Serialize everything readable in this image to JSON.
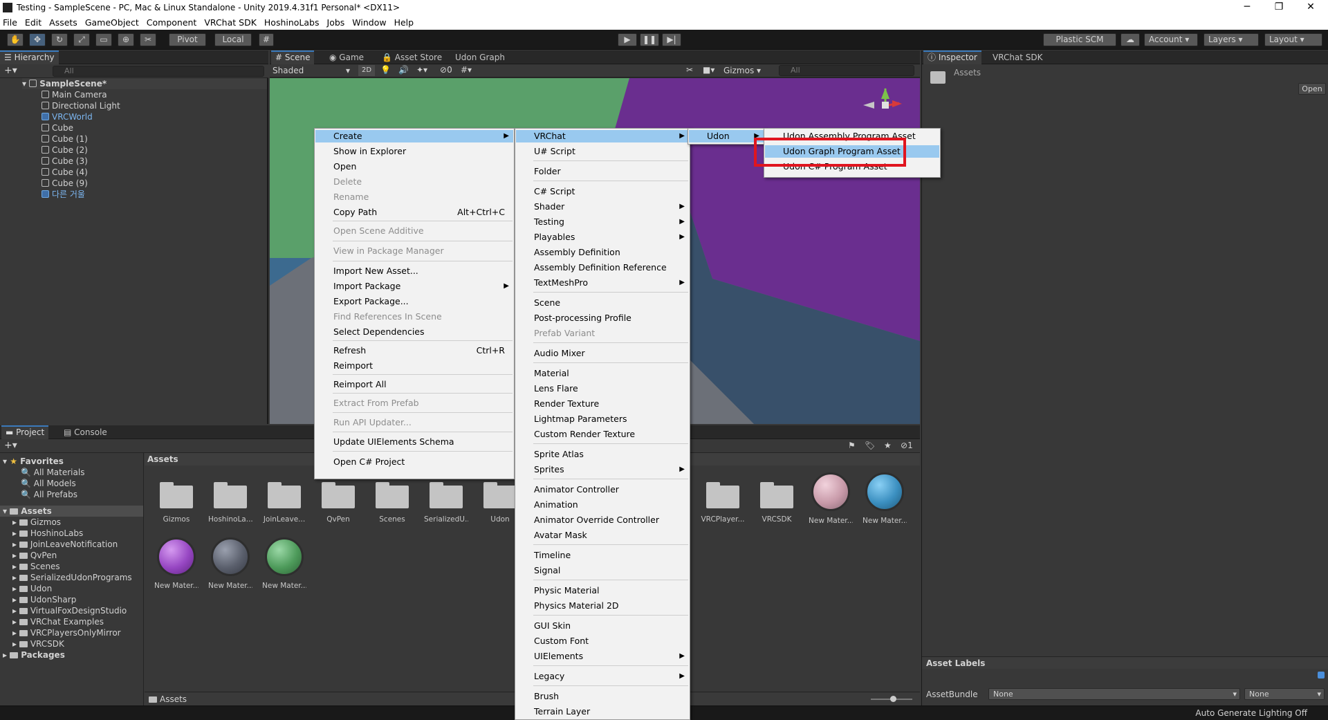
{
  "window": {
    "title": "Testing - SampleScene - PC, Mac & Linux Standalone - Unity 2019.4.31f1 Personal* <DX11>",
    "minimize": "─",
    "restore": "❐",
    "close": "✕"
  },
  "menubar": [
    "File",
    "Edit",
    "Assets",
    "GameObject",
    "Component",
    "VRChat SDK",
    "HoshinoLabs",
    "Jobs",
    "Window",
    "Help"
  ],
  "toolbar": {
    "pivot": "Pivot",
    "local": "Local",
    "plastic": "Plastic SCM",
    "account": "Account",
    "layers": "Layers",
    "layout": "Layout"
  },
  "hierarchy": {
    "tab": "Hierarchy",
    "search_placeholder": "All",
    "scene": "SampleScene*",
    "items": [
      "Main Camera",
      "Directional Light",
      "VRCWorld",
      "Cube",
      "Cube (1)",
      "Cube (2)",
      "Cube (3)",
      "Cube (4)",
      "Cube (9)",
      "다른 거울"
    ]
  },
  "scene_view": {
    "tabs": [
      "Scene",
      "Game",
      "Asset Store",
      "Udon Graph"
    ],
    "shading": "Shaded",
    "mode_2d": "2D",
    "hidden_count": "0",
    "gizmos": "Gizmos",
    "search_placeholder": "All"
  },
  "inspector": {
    "tabs": [
      "Inspector",
      "VRChat SDK"
    ],
    "asset_title": "Assets",
    "open_button": "Open",
    "asset_labels": "Asset Labels",
    "asset_bundle_label": "AssetBundle",
    "bundle_value": "None",
    "variant_value": "None"
  },
  "project": {
    "tabs": [
      "Project",
      "Console"
    ],
    "favorites_label": "Favorites",
    "favorites": [
      "All Materials",
      "All Models",
      "All Prefabs"
    ],
    "assets_label": "Assets",
    "folders": [
      "Gizmos",
      "HoshinoLabs",
      "JoinLeaveNotification",
      "QvPen",
      "Scenes",
      "SerializedUdonPrograms",
      "Udon",
      "UdonSharp",
      "VirtualFoxDesignStudio",
      "VRChat Examples",
      "VRCPlayersOnlyMirror",
      "VRCSDK"
    ],
    "packages_label": "Packages",
    "breadcrumb": "Assets",
    "bottom_path": "Assets",
    "hidden_count": "1",
    "grid_row1": [
      "Gizmos",
      "HoshinoLa...",
      "JoinLeave...",
      "QvPen",
      "Scenes",
      "SerializedU...",
      "Udon"
    ],
    "grid_row1_right": [
      "VRCPlayer...",
      "VRCSDK"
    ],
    "grid_row1_materials": [
      "New Mater...",
      "New Mater..."
    ],
    "grid_row2": [
      "New Mater...",
      "New Mater...",
      "New Mater..."
    ],
    "material_colors": [
      "#c89aa9",
      "#3b8fc0",
      "#9646c2",
      "#5a5f6c",
      "#4d9a5a"
    ]
  },
  "status_bar": {
    "text": "Auto Generate Lighting Off"
  },
  "context_menu": {
    "items": [
      {
        "label": "Create",
        "submenu": true,
        "highlight": true
      },
      {
        "label": "Show in Explorer"
      },
      {
        "label": "Open"
      },
      {
        "label": "Delete",
        "disabled": true
      },
      {
        "label": "Rename",
        "disabled": true
      },
      {
        "label": "Copy Path",
        "shortcut": "Alt+Ctrl+C"
      },
      {
        "label": "Open Scene Additive",
        "disabled": true
      },
      {
        "label": "View in Package Manager",
        "disabled": true
      },
      {
        "label": "Import New Asset..."
      },
      {
        "label": "Import Package",
        "submenu": true
      },
      {
        "label": "Export Package..."
      },
      {
        "label": "Find References In Scene",
        "disabled": true
      },
      {
        "label": "Select Dependencies"
      },
      {
        "label": "Refresh",
        "shortcut": "Ctrl+R"
      },
      {
        "label": "Reimport"
      },
      {
        "label": "Reimport All"
      },
      {
        "label": "Extract From Prefab",
        "disabled": true
      },
      {
        "label": "Run API Updater...",
        "disabled": true
      },
      {
        "label": "Update UIElements Schema"
      },
      {
        "label": "Open C# Project"
      }
    ]
  },
  "create_menu": {
    "items": [
      {
        "label": "VRChat",
        "submenu": true,
        "highlight": true
      },
      {
        "label": "U# Script"
      },
      {
        "label": "Folder"
      },
      {
        "label": "C# Script"
      },
      {
        "label": "Shader",
        "submenu": true
      },
      {
        "label": "Testing",
        "submenu": true
      },
      {
        "label": "Playables",
        "submenu": true
      },
      {
        "label": "Assembly Definition"
      },
      {
        "label": "Assembly Definition Reference"
      },
      {
        "label": "TextMeshPro",
        "submenu": true
      },
      {
        "label": "Scene"
      },
      {
        "label": "Post-processing Profile"
      },
      {
        "label": "Prefab Variant",
        "disabled": true
      },
      {
        "label": "Audio Mixer"
      },
      {
        "label": "Material"
      },
      {
        "label": "Lens Flare"
      },
      {
        "label": "Render Texture"
      },
      {
        "label": "Lightmap Parameters"
      },
      {
        "label": "Custom Render Texture"
      },
      {
        "label": "Sprite Atlas"
      },
      {
        "label": "Sprites",
        "submenu": true
      },
      {
        "label": "Animator Controller"
      },
      {
        "label": "Animation"
      },
      {
        "label": "Animator Override Controller"
      },
      {
        "label": "Avatar Mask"
      },
      {
        "label": "Timeline"
      },
      {
        "label": "Signal"
      },
      {
        "label": "Physic Material"
      },
      {
        "label": "Physics Material 2D"
      },
      {
        "label": "GUI Skin"
      },
      {
        "label": "Custom Font"
      },
      {
        "label": "UIElements",
        "submenu": true
      },
      {
        "label": "Legacy",
        "submenu": true
      },
      {
        "label": "Brush"
      },
      {
        "label": "Terrain Layer"
      }
    ]
  },
  "vrchat_menu": {
    "items": [
      {
        "label": "Udon",
        "submenu": true,
        "highlight": true
      }
    ]
  },
  "udon_menu": {
    "items": [
      {
        "label": "Udon Assembly Program Asset"
      },
      {
        "label": "Udon Graph Program Asset",
        "highlight": true
      },
      {
        "label": "Udon C# Program Asset"
      }
    ],
    "callout_color": "#e0151f"
  },
  "scene_colors": {
    "green": "#5aa06a",
    "purple": "#6a2e8f",
    "gray": "#6c7078",
    "blue": "#38506a"
  }
}
